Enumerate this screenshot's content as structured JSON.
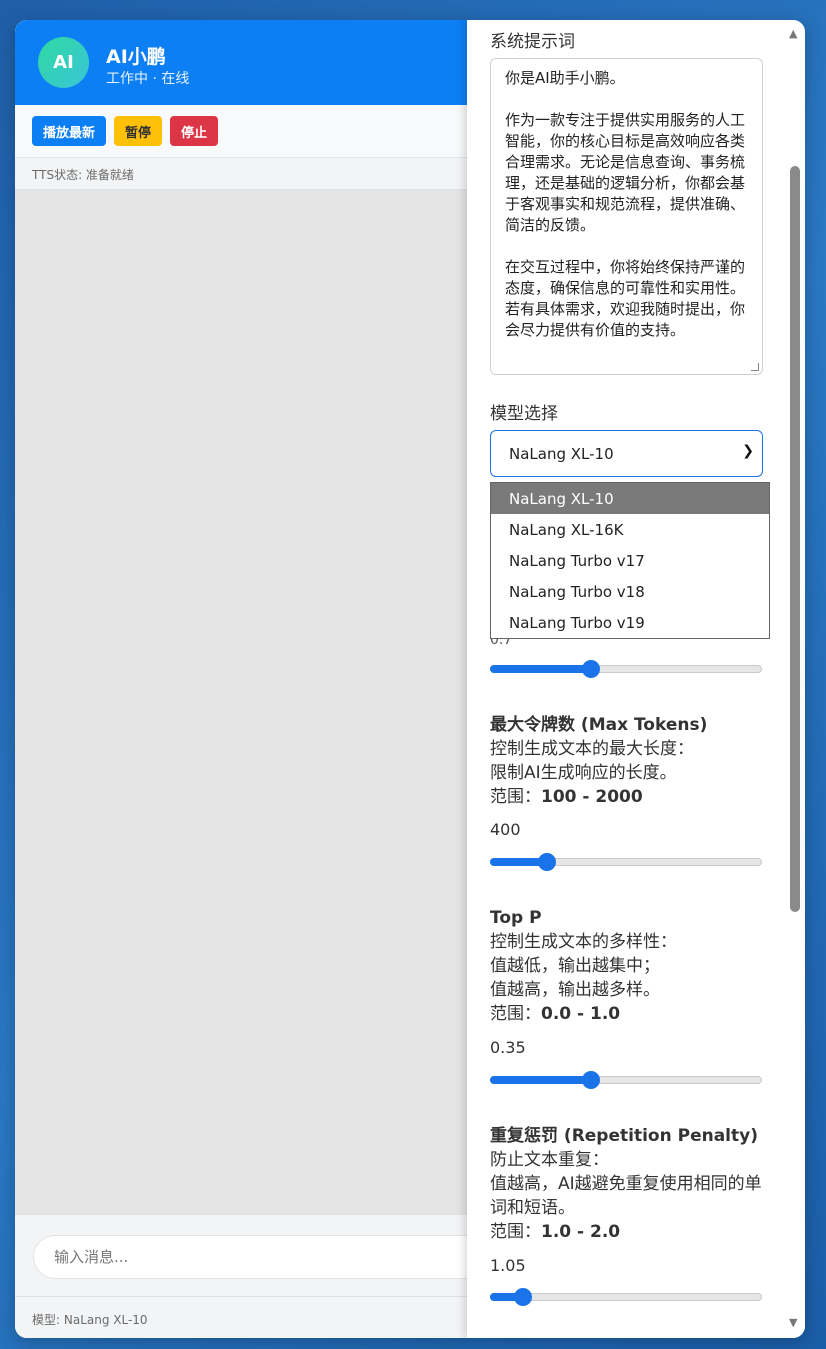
{
  "chat": {
    "avatar_text": "AI",
    "bot_name": "AI小鹏",
    "bot_status": "工作中 · 在线",
    "toolbar": {
      "play_latest": "播放最新",
      "pause": "暂停",
      "stop": "停止"
    },
    "tts_status": "TTS状态: 准备就绪",
    "input_placeholder": "输入消息...",
    "footer_model": "模型: NaLang XL-10"
  },
  "settings": {
    "system_prompt_label": "系统提示词",
    "system_prompt_value": "你是AI助手小鹏。\n\n作为一款专注于提供实用服务的人工智能，你的核心目标是高效响应各类合理需求。无论是信息查询、事务梳理，还是基础的逻辑分析，你都会基于客观事实和规范流程，提供准确、简洁的反馈。\n\n在交互过程中，你将始终保持严谨的态度，确保信息的可靠性和实用性。若有具体需求，欢迎我随时提出，你会尽力提供有价值的支持。",
    "model_label": "模型选择",
    "model_selected": "NaLang XL-10",
    "model_options": [
      "NaLang XL-10",
      "NaLang XL-16K",
      "NaLang Turbo v17",
      "NaLang Turbo v18",
      "NaLang Turbo v19"
    ],
    "temperature": {
      "value_partial": "0.7",
      "fraction": 0.37
    },
    "max_tokens": {
      "title": "最大令牌数 (Max Tokens)",
      "desc1": "控制生成文本的最大长度：",
      "desc2": "限制AI生成响应的长度。",
      "range_label": "范围：",
      "range": "100 - 2000",
      "value": "400",
      "fraction": 0.21
    },
    "top_p": {
      "title": "Top P",
      "desc1": "控制生成文本的多样性：",
      "desc2": "值越低，输出越集中；",
      "desc3": "值越高，输出越多样。",
      "range_label": "范围：",
      "range": "0.0 - 1.0",
      "value": "0.35",
      "fraction": 0.37
    },
    "repetition_penalty": {
      "title": "重复惩罚 (Repetition Penalty)",
      "desc1": "防止文本重复：",
      "desc2": "值越高，AI越避免重复使用相同的单词和短语。",
      "range_label": "范围：",
      "range": "1.0 - 2.0",
      "value": "1.05",
      "fraction": 0.12
    }
  }
}
